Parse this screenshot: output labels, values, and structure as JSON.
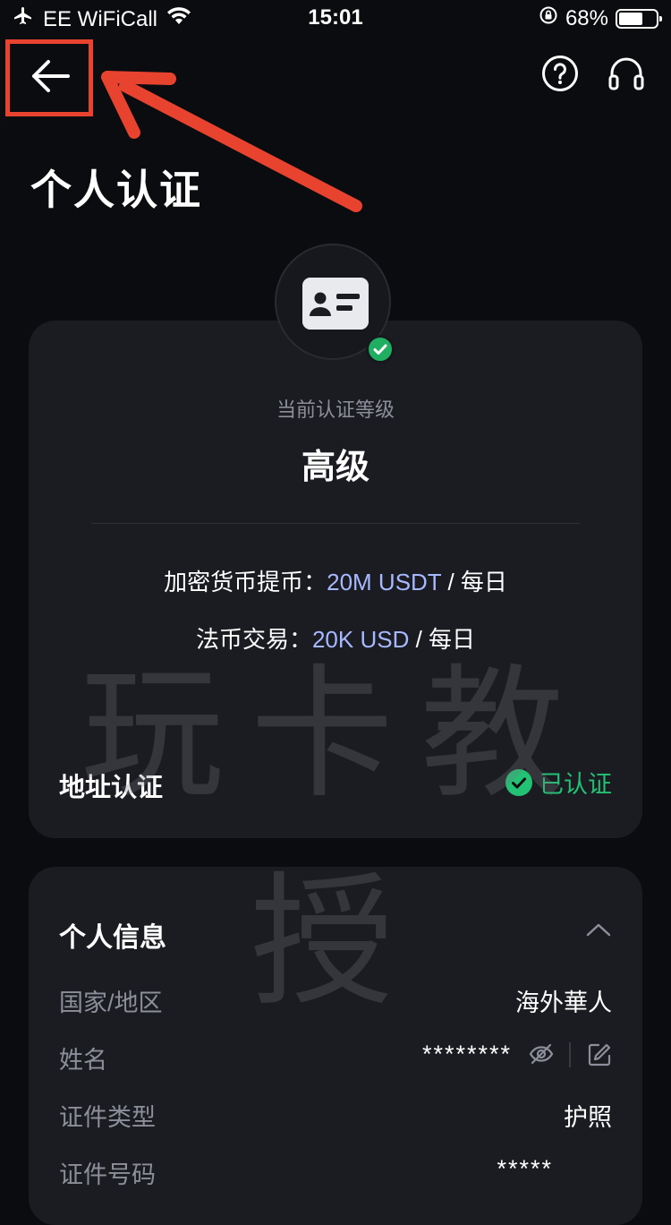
{
  "status_bar": {
    "carrier": "EE WiFiCall",
    "time": "15:01",
    "battery": "68%",
    "battery_level": 0.68
  },
  "nav": {
    "back_icon": "arrow-left-icon",
    "help_icon": "question-circle-icon",
    "support_icon": "headset-icon"
  },
  "page": {
    "title": "个人认证"
  },
  "verification": {
    "badge_icon": "id-card-icon",
    "level_caption": "当前认证等级",
    "level": "高级",
    "crypto_withdraw_label": "加密货币提币：",
    "crypto_withdraw_value": "20M USDT",
    "crypto_withdraw_period": " / 每日",
    "fiat_trade_label": "法币交易：",
    "fiat_trade_value": "20K USD",
    "fiat_trade_period": " / 每日",
    "address_label": "地址认证",
    "address_status": "已认证"
  },
  "personal_info": {
    "title": "个人信息",
    "rows": [
      {
        "label": "国家/地区",
        "value": "海外華人"
      },
      {
        "label": "姓名",
        "value": "********"
      },
      {
        "label": "证件类型",
        "value": "护照"
      },
      {
        "label": "证件号码",
        "value": "*****"
      }
    ]
  },
  "watermark": "玩卡教授",
  "colors": {
    "background": "#0b0c0f",
    "card": "#1b1c22",
    "accent_blue": "#a6b8ff",
    "success_green": "#22c174",
    "annotation_red": "#e8432f"
  }
}
